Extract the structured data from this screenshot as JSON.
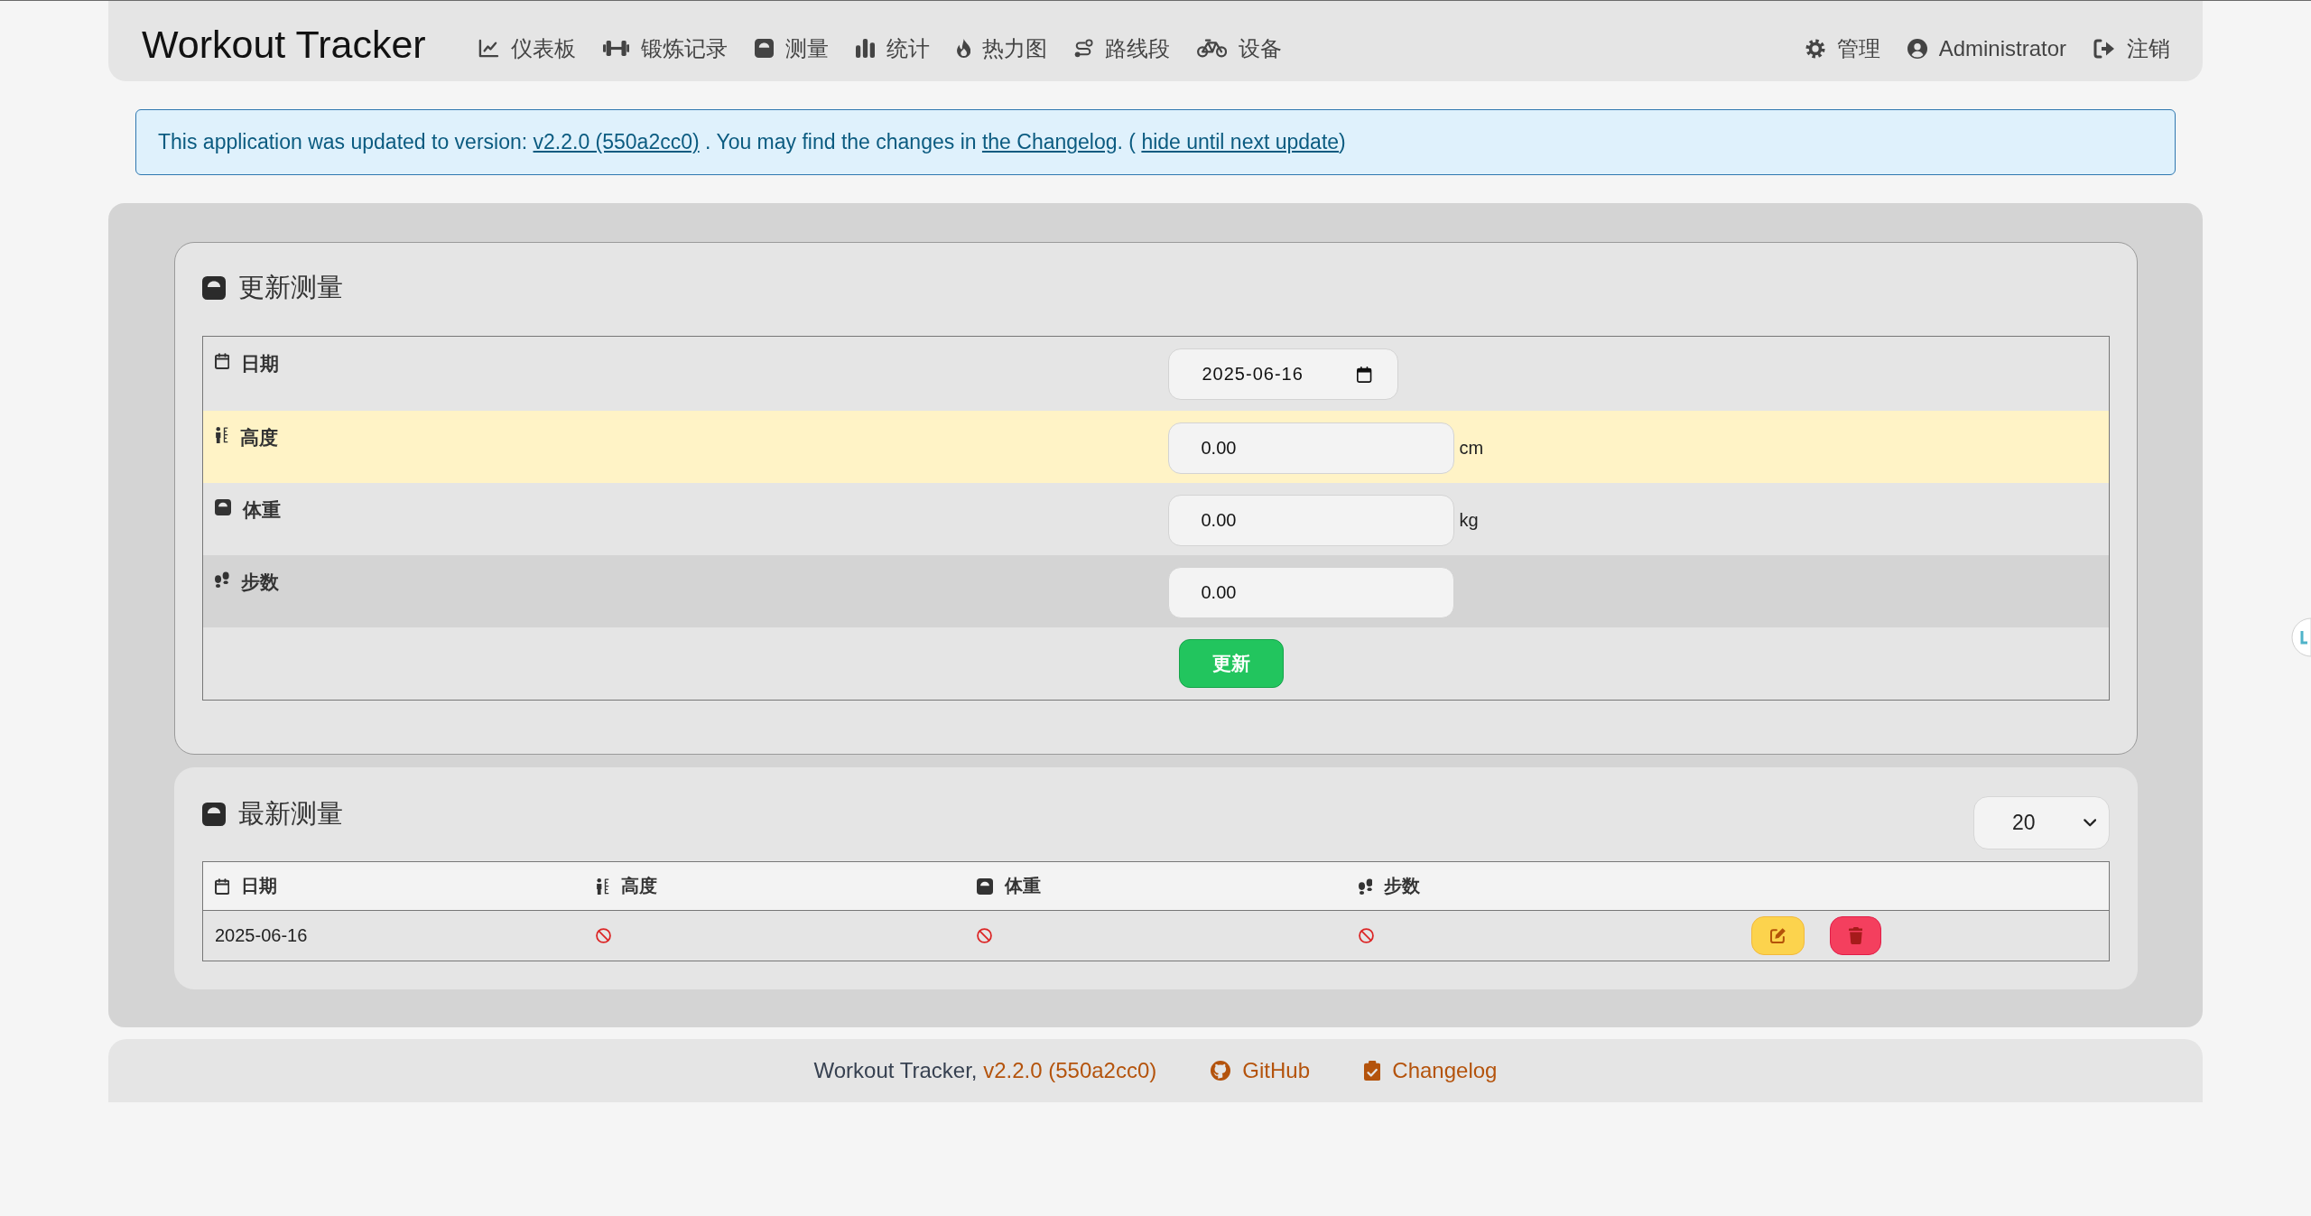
{
  "header": {
    "brand": "Workout Tracker",
    "nav": [
      {
        "label": "仪表板"
      },
      {
        "label": "锻炼记录"
      },
      {
        "label": "测量"
      },
      {
        "label": "统计"
      },
      {
        "label": "热力图"
      },
      {
        "label": "路线段"
      },
      {
        "label": "设备"
      }
    ],
    "user_menu": [
      {
        "label": "管理"
      },
      {
        "label": "Administrator"
      },
      {
        "label": "注销"
      }
    ]
  },
  "notice": {
    "parts": [
      {
        "kind": "text",
        "text": "This application was updated to version: "
      },
      {
        "kind": "link",
        "text": "v2.2.0 (550a2cc0)"
      },
      {
        "kind": "text",
        "text": " . You may find the changes in "
      },
      {
        "kind": "link",
        "text": "the Changelog"
      },
      {
        "kind": "text",
        "text": ". ( "
      },
      {
        "kind": "link",
        "text": "hide until next update"
      },
      {
        "kind": "text",
        "text": ")"
      }
    ]
  },
  "update_form": {
    "title": "更新测量",
    "fields": [
      {
        "kind": "date",
        "label": "日期",
        "value": "2025-06-16",
        "highlighted": false
      },
      {
        "kind": "number",
        "label": "高度",
        "value": "0.00",
        "unit": "cm",
        "highlighted": true
      },
      {
        "kind": "number",
        "label": "体重",
        "value": "0.00",
        "unit": "kg",
        "highlighted": false
      },
      {
        "kind": "number",
        "label": "步数",
        "value": "0.00",
        "highlighted": false
      }
    ],
    "submit": "更新"
  },
  "recent": {
    "title": "最新测量",
    "page_size": "20",
    "columns": [
      "日期",
      "高度",
      "体重",
      "步数"
    ],
    "rows": [
      {
        "date": "2025-06-16",
        "values": [
          {
            "missing": true
          },
          {
            "missing": true
          },
          {
            "missing": true
          }
        ]
      }
    ]
  },
  "footer": {
    "app": "Workout Tracker,",
    "version": "v2.2.0 (550a2cc0)",
    "links": [
      "GitHub",
      "Changelog"
    ]
  }
}
